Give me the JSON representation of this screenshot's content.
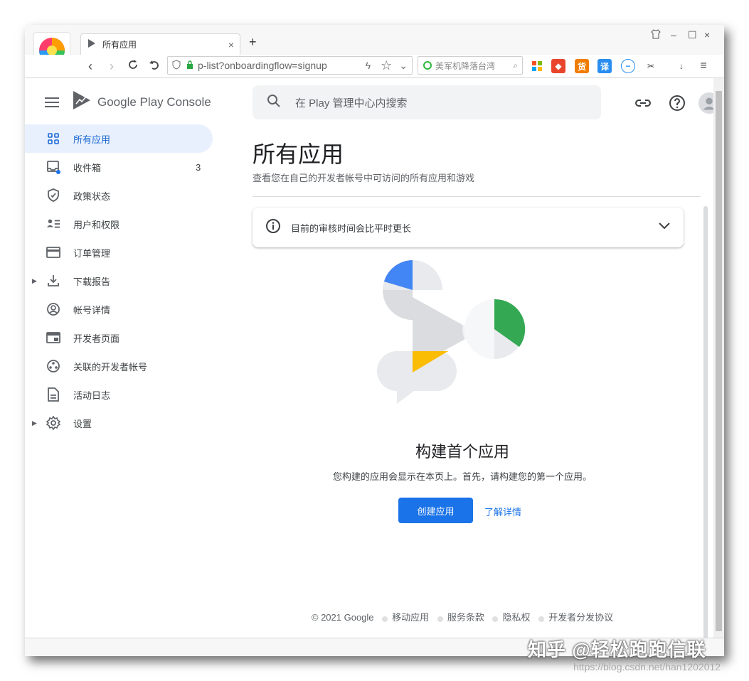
{
  "browser": {
    "tab_title": "所有应用",
    "tab_close": "×",
    "new_tab": "+",
    "url": "p-list?onboardingflow=signup",
    "search_hint": "美军机降落台湾",
    "win_min": "–",
    "win_max": "☐",
    "win_close": "×"
  },
  "app": {
    "brand": "Google Play Console",
    "search_placeholder": "在 Play 管理中心内搜索",
    "nav": [
      {
        "label": "所有应用",
        "icon": "grid-icon"
      },
      {
        "label": "收件箱",
        "icon": "inbox-icon",
        "count": "3"
      },
      {
        "label": "政策状态",
        "icon": "shield-icon"
      },
      {
        "label": "用户和权限",
        "icon": "users-icon"
      },
      {
        "label": "订单管理",
        "icon": "card-icon"
      },
      {
        "label": "下载报告",
        "icon": "download-icon"
      },
      {
        "label": "帐号详情",
        "icon": "account-icon"
      },
      {
        "label": "开发者页面",
        "icon": "page-icon"
      },
      {
        "label": "关联的开发者帐号",
        "icon": "linked-icon"
      },
      {
        "label": "活动日志",
        "icon": "log-icon"
      },
      {
        "label": "设置",
        "icon": "gear-icon"
      }
    ],
    "page_title": "所有应用",
    "page_subtitle": "查看您在自己的开发者帐号中可访问的所有应用和游戏",
    "banner_text": "目前的审核时间会比平时更长",
    "empty_title": "构建首个应用",
    "empty_subtitle": "您构建的应用会显示在本页上。首先，请构建您的第一个应用。",
    "create_button": "创建应用",
    "learn_more": "了解详情",
    "footer": {
      "copyright": "© 2021 Google",
      "links": [
        "移动应用",
        "服务条款",
        "隐私权",
        "开发者分发协议"
      ]
    }
  },
  "overlay": {
    "watermark": "知乎 @轻松跑跑信联",
    "watermark_url": "https://blog.csdn.net/han1202012"
  },
  "colors": {
    "accent": "#1a73e8",
    "active_bg": "#e8f0fe",
    "illus_blue": "#4285f4",
    "illus_green": "#34a853",
    "illus_yellow": "#fbbc04"
  }
}
